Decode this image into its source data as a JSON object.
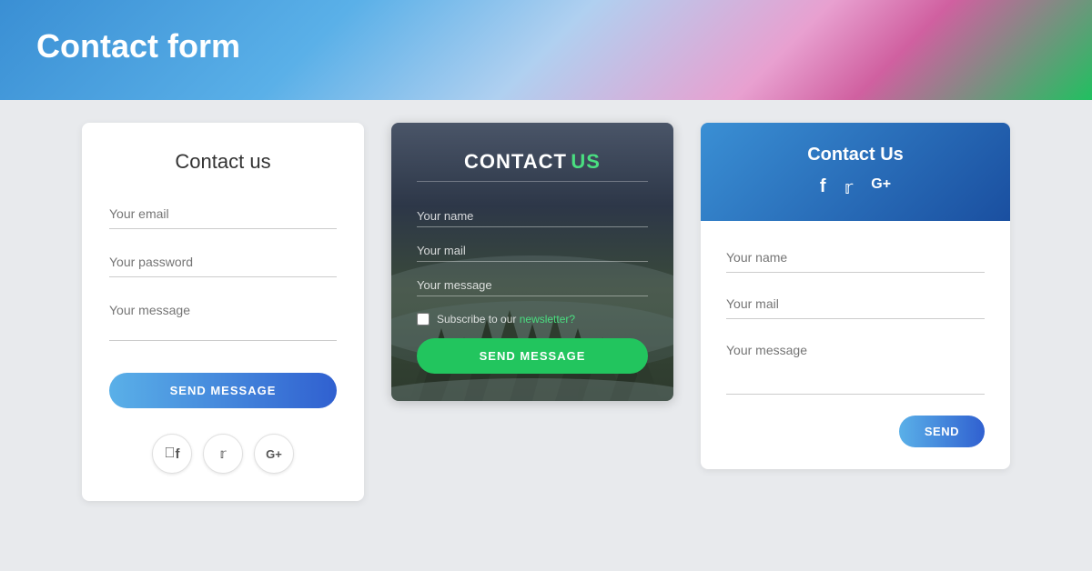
{
  "header": {
    "title": "Contact form"
  },
  "card1": {
    "title": "Contact us",
    "email_placeholder": "Your email",
    "password_placeholder": "Your password",
    "message_placeholder": "Your message",
    "send_button": "SEND MESSAGE",
    "social": {
      "facebook": "f",
      "twitter": "t",
      "googleplus": "G+"
    }
  },
  "card2": {
    "title_contact": "CONTACT",
    "title_us": "US",
    "name_label": "Your name",
    "mail_label": "Your mail",
    "message_label": "Your message",
    "subscribe_label": "Subscribe to our",
    "newsletter_link": "newsletter?",
    "send_button": "SEND MESSAGE"
  },
  "card3": {
    "title": "Contact Us",
    "social": {
      "facebook": "f",
      "twitter": "t",
      "googleplus": "G+"
    },
    "name_placeholder": "Your name",
    "mail_placeholder": "Your mail",
    "message_placeholder": "Your message",
    "send_button": "SEND"
  }
}
